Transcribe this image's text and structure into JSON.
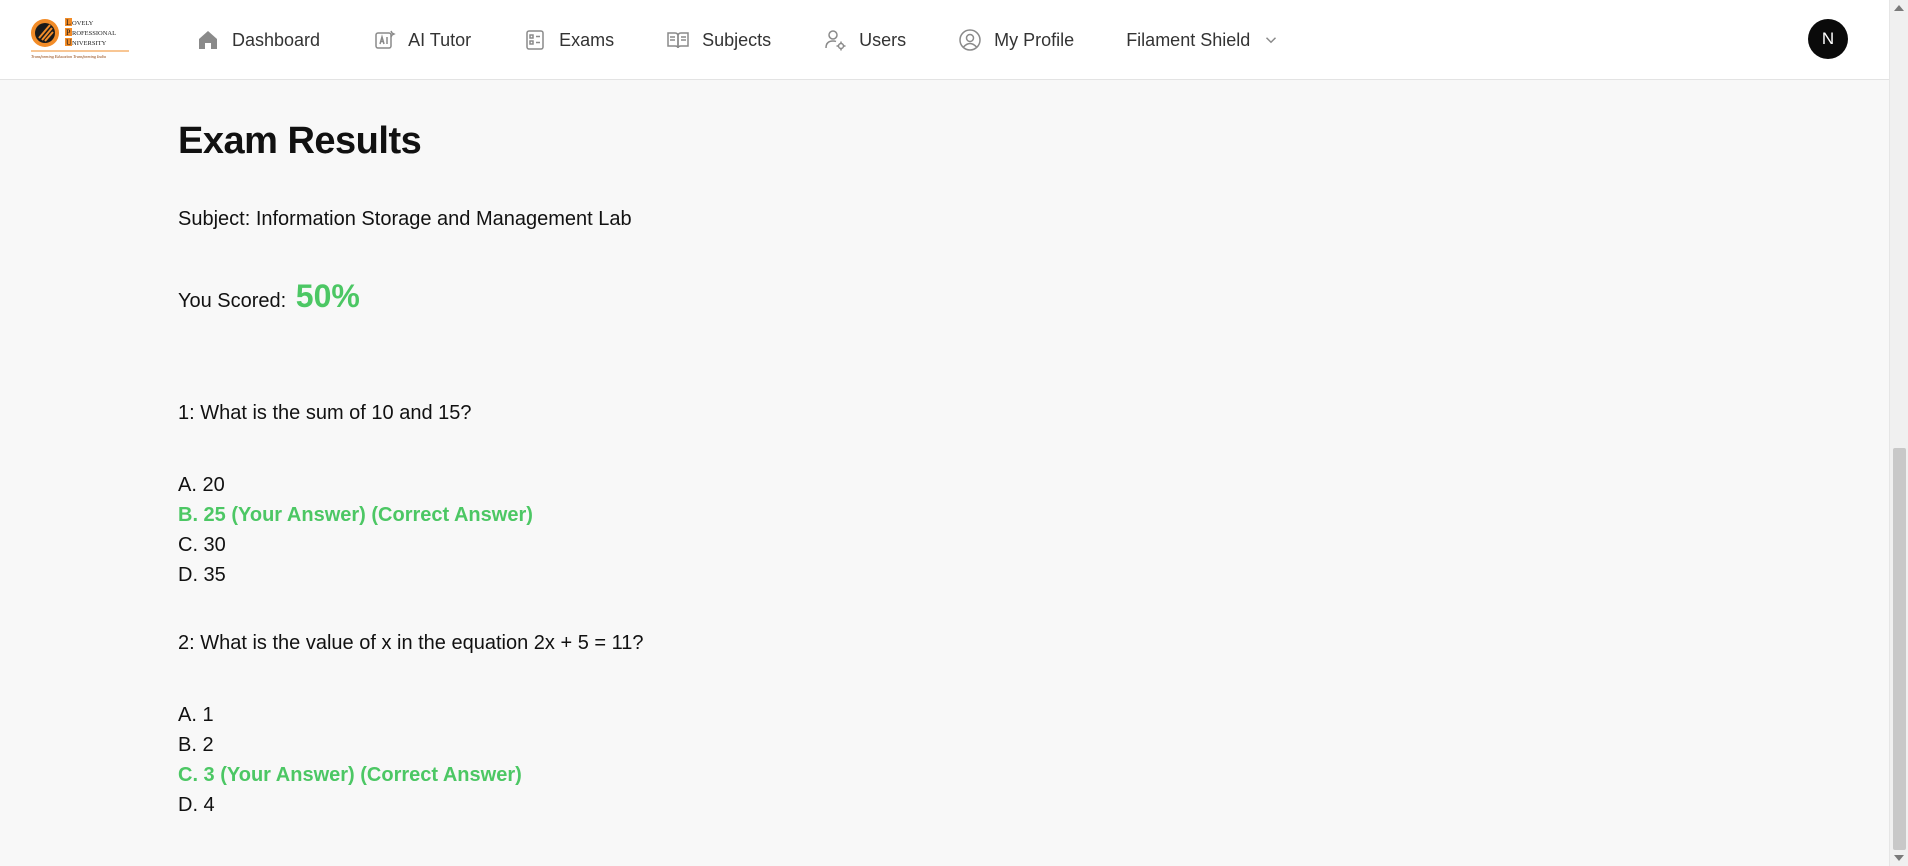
{
  "app": {
    "logo": {
      "lines": [
        "LOVELY",
        "PROFESSIONAL",
        "UNIVERSITY"
      ],
      "tagline": "Transforming Education Transforming India"
    }
  },
  "nav": {
    "items": [
      {
        "label": "Dashboard",
        "icon": "home-icon"
      },
      {
        "label": "AI Tutor",
        "icon": "ai-icon"
      },
      {
        "label": "Exams",
        "icon": "exam-icon"
      },
      {
        "label": "Subjects",
        "icon": "book-icon"
      },
      {
        "label": "Users",
        "icon": "users-gear-icon"
      },
      {
        "label": "My Profile",
        "icon": "user-circle-icon"
      },
      {
        "label": "Filament Shield",
        "icon": "chevron-down-icon"
      }
    ],
    "avatar_initial": "N"
  },
  "page": {
    "title": "Exam Results",
    "subject_line": "Subject: Information Storage and Management Lab",
    "score_label": "You Scored:",
    "score_value": "50%"
  },
  "questions": [
    {
      "text": "1: What is the sum of 10 and 15?",
      "options": [
        "A. 20",
        "B. 25 (Your Answer) (Correct Answer)",
        "C. 30",
        "D. 35"
      ],
      "correct_index": 1
    },
    {
      "text": "2: What is the value of x in the equation 2x + 5 = 11?",
      "options": [
        "A. 1",
        "B. 2",
        "C. 3 (Your Answer) (Correct Answer)",
        "D. 4"
      ],
      "correct_index": 2
    }
  ],
  "colors": {
    "accent_green": "#4cc764",
    "avatar_bg": "#0a0a0a"
  }
}
